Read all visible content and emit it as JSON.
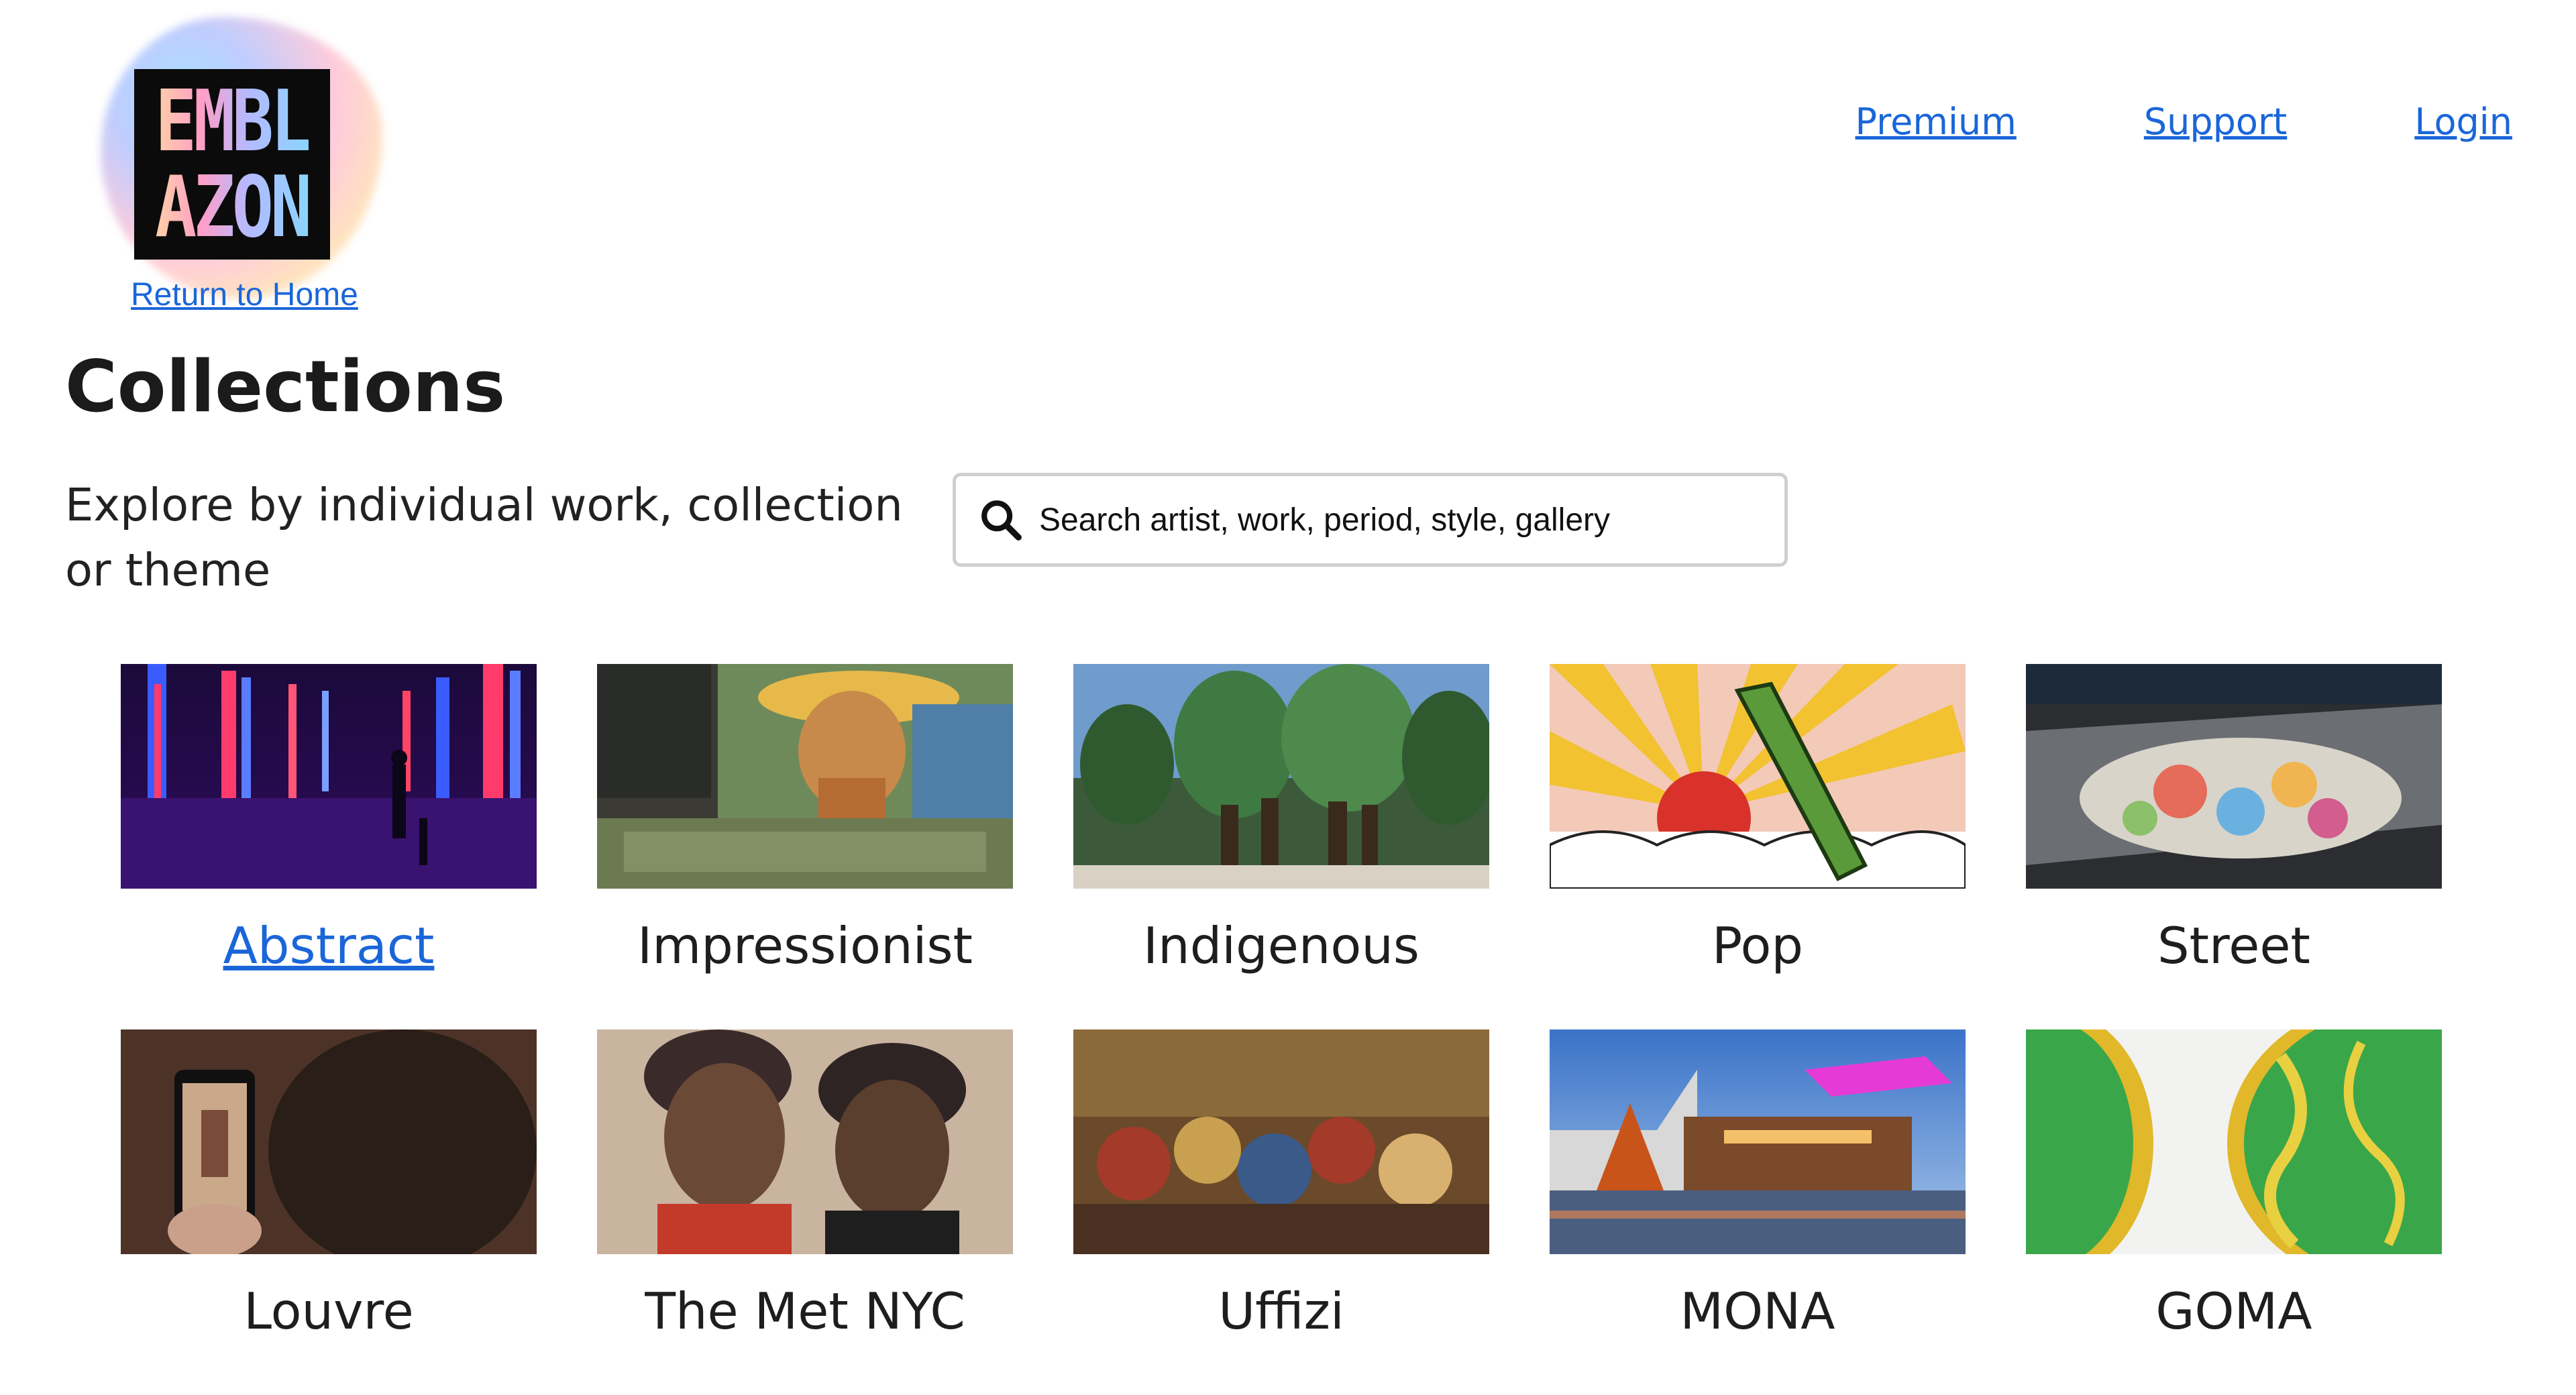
{
  "brand": {
    "logo_line1": "EMBL",
    "logo_line2": "AZON",
    "return_home": "Return to Home"
  },
  "nav": {
    "premium": "Premium",
    "support": "Support",
    "login": "Login"
  },
  "page": {
    "title": "Collections",
    "subtitle": "Explore by individual work, collection or theme"
  },
  "search": {
    "placeholder": "Search artist, work, period, style, gallery",
    "value": ""
  },
  "collections": [
    {
      "label": "Abstract",
      "is_link": true
    },
    {
      "label": "Impressionist"
    },
    {
      "label": "Indigenous"
    },
    {
      "label": "Pop"
    },
    {
      "label": "Street"
    },
    {
      "label": "Louvre"
    },
    {
      "label": "The Met NYC"
    },
    {
      "label": "Uffizi"
    },
    {
      "label": "MONA"
    },
    {
      "label": "GOMA"
    }
  ],
  "colors": {
    "link": "#1a66d9",
    "text": "#222222"
  }
}
